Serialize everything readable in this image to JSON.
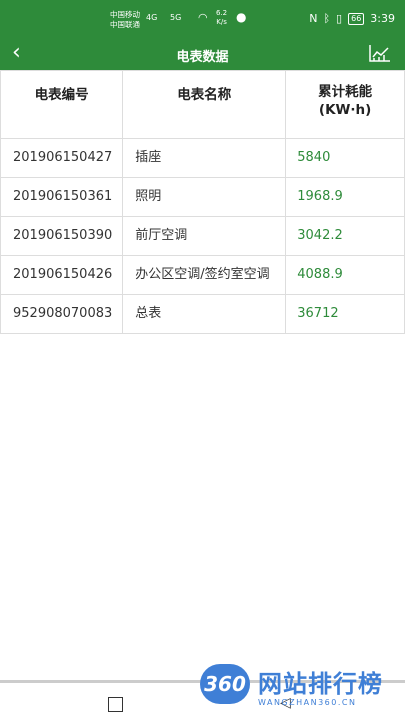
{
  "status_bar": {
    "carrier1": "中国移动",
    "carrier2": "中国联通",
    "net1": "4G",
    "net2": "5G",
    "speed": "6.2",
    "speed_unit": "K/s",
    "battery": "66",
    "time": "3:39"
  },
  "app_bar": {
    "title": "电表数据"
  },
  "table": {
    "headers": [
      "电表编号",
      "电表名称",
      "累计耗能",
      "(KW·h)"
    ],
    "rows": [
      {
        "id": "201906150427",
        "name": "插座",
        "value": "5840"
      },
      {
        "id": "201906150361",
        "name": "照明",
        "value": "1968.9"
      },
      {
        "id": "201906150390",
        "name": "前厅空调",
        "value": "3042.2"
      },
      {
        "id": "201906150426",
        "name": "办公区空调/签约室空调",
        "value": "4088.9"
      },
      {
        "id": "952908070083",
        "name": "总表",
        "value": "36712"
      }
    ]
  },
  "watermark": {
    "badge": "360",
    "text": "网站排行榜",
    "sub": "WANGZHAN360.CN"
  },
  "colors": {
    "primary": "#2e8b3a",
    "value_text": "#2e8b3a",
    "watermark": "#3f7fd6"
  }
}
